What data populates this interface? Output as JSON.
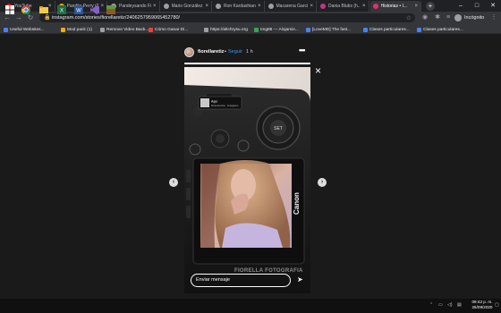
{
  "browser": {
    "tabs": [
      {
        "label": "YouTube",
        "favicon": "youtube-icon",
        "color": "#ff0000",
        "active": false
      },
      {
        "label": "Pandita Perry (T...",
        "favicon": "google-icon",
        "color": "#f9ab00",
        "active": false
      },
      {
        "label": "Pandeysando Fir...",
        "favicon": "loading-icon",
        "color": "#9aa0a6",
        "active": false
      },
      {
        "label": "Mario González ...",
        "favicon": "loading-icon",
        "color": "#9aa0a6",
        "active": false
      },
      {
        "label": "Ron Kardashian ...",
        "favicon": "loading-icon",
        "color": "#9aa0a6",
        "active": false
      },
      {
        "label": "Macarena Garcí...",
        "favicon": "loading-icon",
        "color": "#9aa0a6",
        "active": false
      },
      {
        "label": "Dania Blubs (h...",
        "favicon": "instagram-icon",
        "color": "#c13584",
        "active": false
      },
      {
        "label": "Historias • I...",
        "favicon": "instagram-icon",
        "color": "#e1306c",
        "active": true
      }
    ],
    "new_tab": "+",
    "url": "instagram.com/stories/fiorellaretiz/2406257959065452780/",
    "incognito_label": "Incógnito",
    "bookmarks": [
      {
        "label": "Useful Websites...",
        "color": "#4285f4"
      },
      {
        "label": "Mod pack (1)",
        "color": "#f9ab00"
      },
      {
        "label": "Remove Video Back...",
        "color": "#9aa0a6"
      },
      {
        "label": "Cómo Ganar Di...",
        "color": "#ea4335"
      },
      {
        "label": "https://altchrysu.org",
        "color": "#9aa0a6"
      },
      {
        "label": "Img88 — Alojamie...",
        "color": "#34a853"
      },
      {
        "label": "[LoveMD] The fast...",
        "color": "#4285f4"
      },
      {
        "label": "Clases particulares...",
        "color": "#4285f4"
      },
      {
        "label": "Clases particulares...",
        "color": "#4285f4"
      }
    ]
  },
  "story": {
    "username": "fiorellaretiz",
    "separator": "•",
    "follow_label": "Seguir",
    "time": "1 h",
    "more_label": "•••",
    "progress": 1.0,
    "music_sticker_title": "Aquí",
    "music_sticker_subtitle": "Rosa Hecha · Instagram",
    "camera_brand": "Canon",
    "watermark": "FIORELLA FOTOGRAFIA",
    "reply_placeholder": "Enviar mensaje",
    "close_label": "×",
    "prev_label": "‹",
    "next_label": "›"
  },
  "taskbar": {
    "time": "09:42 p. m.",
    "date": "25/09/2020"
  }
}
